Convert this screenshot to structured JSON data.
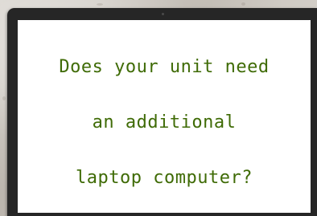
{
  "screen": {
    "text_color": "#3f6b06",
    "background_color": "#ffffff",
    "lines": [
      "Does your unit need",
      "an additional",
      "laptop computer?"
    ]
  },
  "frame": {
    "bezel_color": "#262626"
  }
}
